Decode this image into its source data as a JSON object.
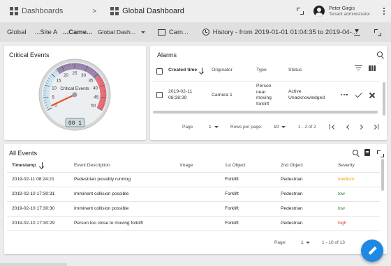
{
  "topbar": {
    "breadcrumb_root": "Dashboards",
    "separator": ">",
    "breadcrumb_current": "Global Dashboard",
    "user_name": "Peter Girgis",
    "user_role": "Tenant administrator"
  },
  "toolbar": {
    "items": [
      "Global",
      "...Site A",
      "...Came...",
      "Global Dash..."
    ],
    "entity_label": "Cam...",
    "timewindow": "History - from 2019-01-01 01:04:35 to 2019-04-..."
  },
  "critical_events": {
    "title": "Critical Events",
    "gauge_label": "Critical Events",
    "ticks": [
      "0",
      "5",
      "10",
      "15",
      "20",
      "25",
      "30",
      "35",
      "40",
      "45",
      "50"
    ],
    "value": 1,
    "lcd": "00 1",
    "min": 0,
    "max": 50,
    "colors": {
      "low": "#cfe4f2",
      "mid": "#9b87b0",
      "high": "#e8707a",
      "needle": "#e8512a"
    }
  },
  "alarms": {
    "title": "Alarms",
    "headers": {
      "created_time": "Created time",
      "originator": "Originator",
      "type": "Type",
      "status": "Status"
    },
    "rows": [
      {
        "created_date": "2019-02-11",
        "created_clock": "08:38:39",
        "originator": "Camera 1",
        "type": [
          "Person",
          "near",
          "moving",
          "forklift"
        ],
        "status": [
          "Active",
          "Unacknowledged"
        ]
      }
    ],
    "pagination": {
      "page_label": "Page",
      "page": "1",
      "rows_label": "Rows per page:",
      "rows": "10",
      "range": "1 - 2 of 2"
    }
  },
  "all_events": {
    "title": "All Events",
    "headers": {
      "timestamp": "Timestamp",
      "description": "Event Description",
      "image": "Image",
      "first_object": "1st Object",
      "second_object": "2nd Object",
      "severity": "Severity"
    },
    "rows": [
      {
        "timestamp": "2019-02-11 08:24:21",
        "description": "Pedestrian possibly running",
        "first_object": "Forklift",
        "second_object": "Pedestrian",
        "severity": "medium"
      },
      {
        "timestamp": "2019-02-10 17:30:31",
        "description": "Imminent collision possible",
        "first_object": "Forklift",
        "second_object": "Pedestrian",
        "severity": "low"
      },
      {
        "timestamp": "2019-02-10 17:30:30",
        "description": "Imminent collision possible",
        "first_object": "Forklift",
        "second_object": "Pedestrian",
        "severity": "low"
      },
      {
        "timestamp": "2019-02-10 17:30:29",
        "description": "Person too close to moving forklift",
        "first_object": "Forklift",
        "second_object": "Pedestrian",
        "severity": "high"
      }
    ],
    "pagination": {
      "page_label": "Page:",
      "page": "1",
      "range": "1 - 10 of 13"
    }
  }
}
